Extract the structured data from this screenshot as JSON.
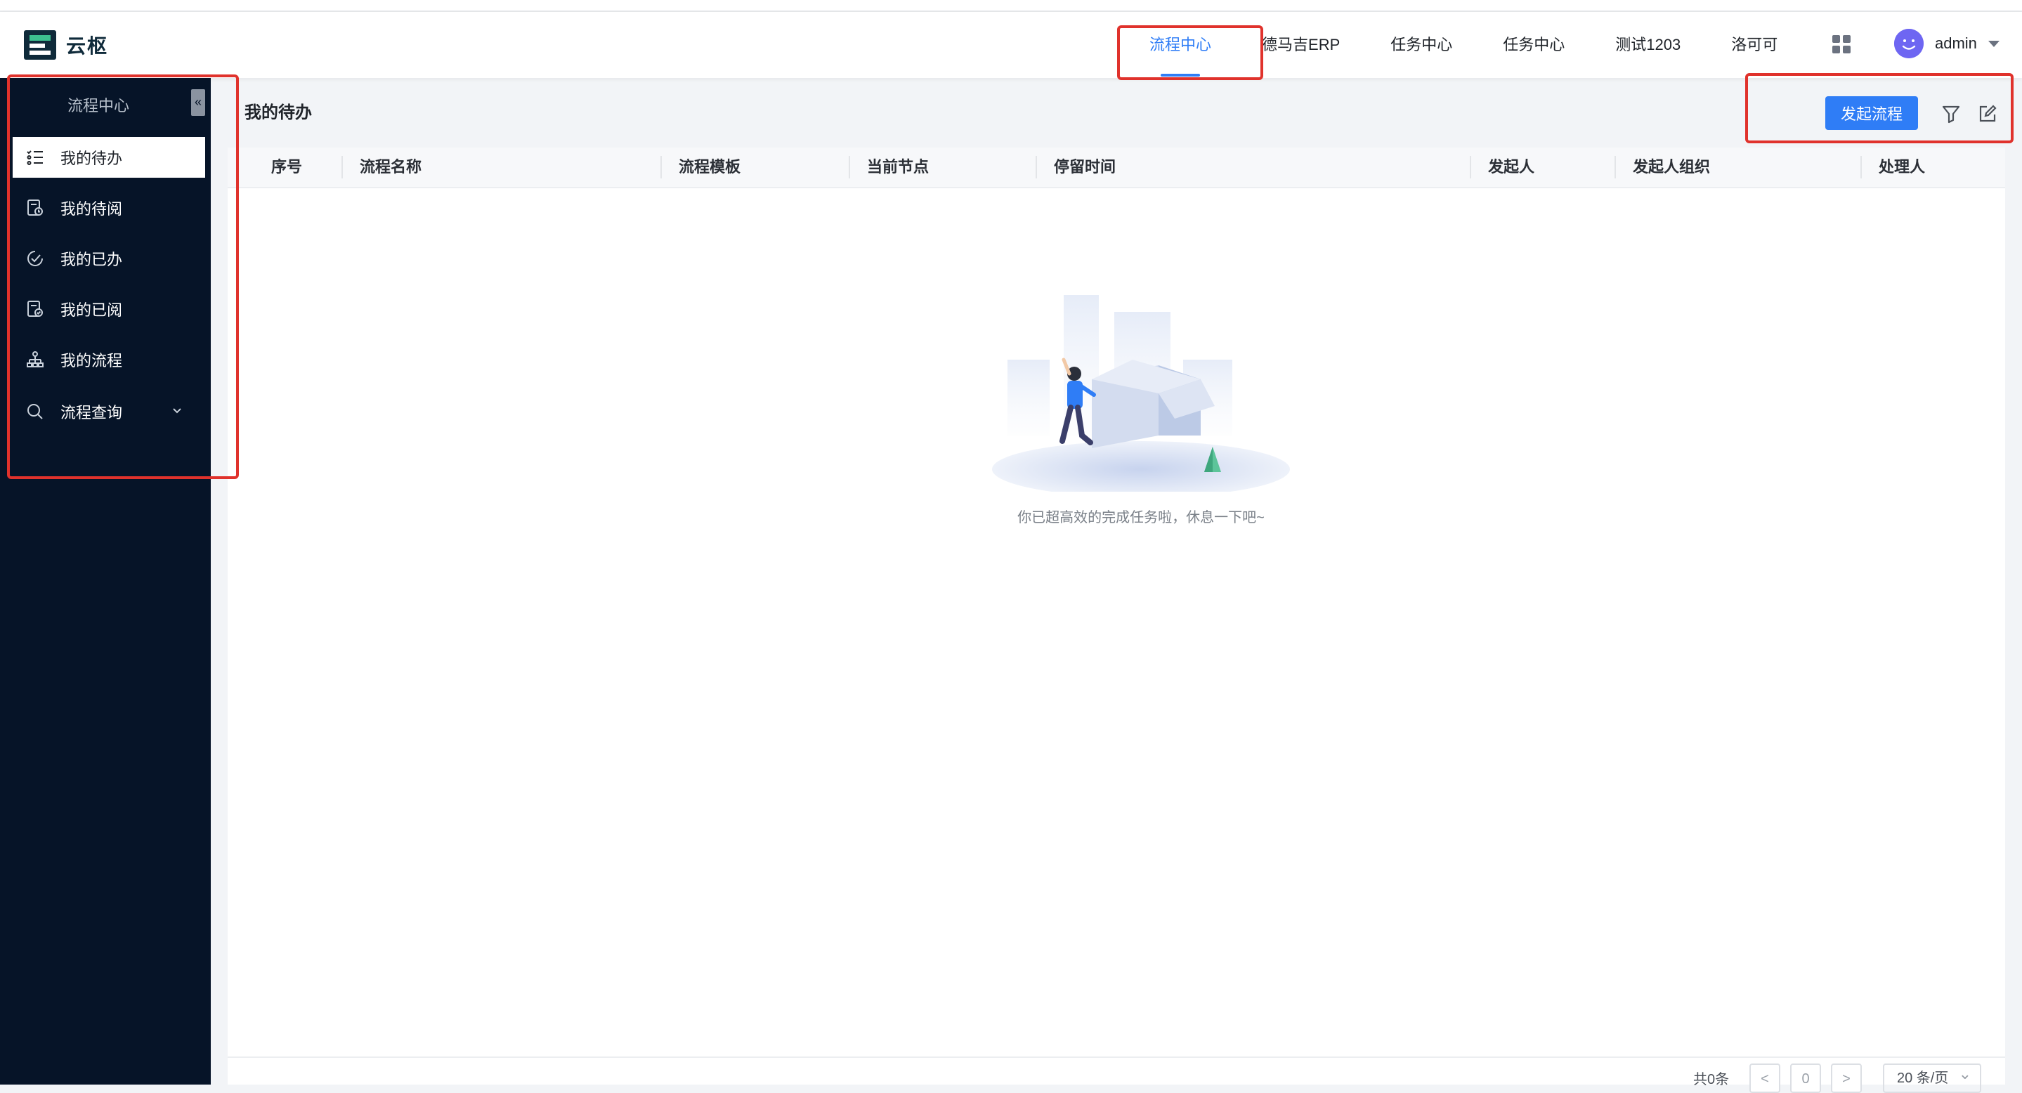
{
  "header": {
    "logo_text": "云枢",
    "nav": [
      {
        "label": "流程中心",
        "active": true
      },
      {
        "label": "德马吉ERP"
      },
      {
        "label": "任务中心"
      },
      {
        "label": "任务中心"
      },
      {
        "label": "测试1203"
      },
      {
        "label": "洛可可"
      }
    ],
    "user": {
      "name": "admin"
    }
  },
  "sidebar": {
    "title": "流程中心",
    "collapse_icon": "«",
    "items": [
      {
        "label": "我的待办",
        "icon": "todo-list-icon",
        "active": true
      },
      {
        "label": "我的待阅",
        "icon": "to-read-icon"
      },
      {
        "label": "我的已办",
        "icon": "done-icon"
      },
      {
        "label": "我的已阅",
        "icon": "read-icon"
      },
      {
        "label": "我的流程",
        "icon": "workflow-icon"
      },
      {
        "label": "流程查询",
        "icon": "search-icon",
        "expandable": true
      }
    ]
  },
  "main": {
    "title": "我的待办",
    "start_button": "发起流程",
    "columns": [
      "序号",
      "流程名称",
      "流程模板",
      "当前节点",
      "停留时间",
      "发起人",
      "发起人组织",
      "处理人"
    ],
    "empty_text": "你已超高效的完成任务啦，休息一下吧~"
  },
  "pagination": {
    "total": "共0条",
    "prev": "<",
    "current": "0",
    "next": ">",
    "page_size": "20 条/页"
  },
  "colors": {
    "primary": "#2f7df6",
    "sidebar_bg": "#061428",
    "annotation": "#e0322c"
  }
}
